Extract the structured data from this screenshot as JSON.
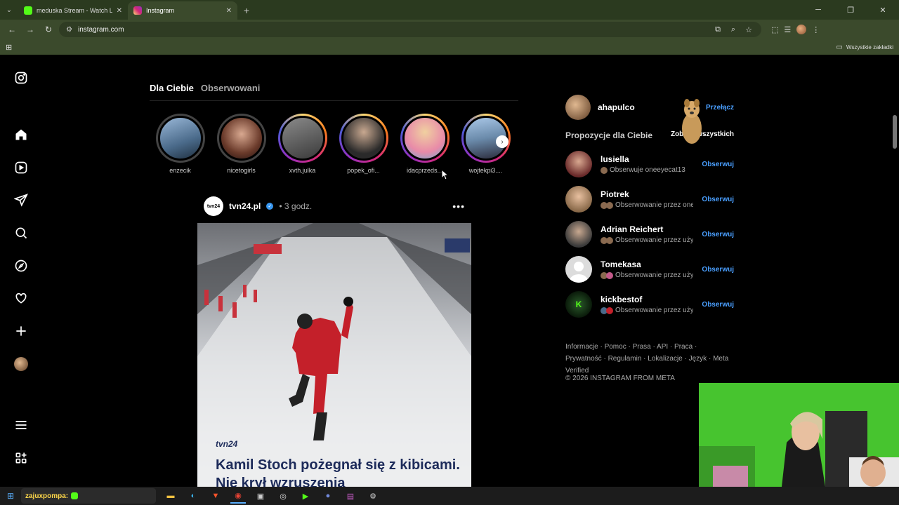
{
  "browser": {
    "tabs": [
      {
        "title": "meduska Stream - Watch Live o",
        "favicon_color": "#53fc18",
        "active": false
      },
      {
        "title": "Instagram",
        "favicon_color": "#e1306c",
        "active": true
      }
    ],
    "url": "instagram.com",
    "bookmarks_all_label": "Wszystkie zakładki"
  },
  "feed": {
    "tab_for_you": "Dla Ciebie",
    "tab_following": "Obserwowani"
  },
  "stories": [
    {
      "name": "enzecik",
      "ring": "seen",
      "color": "#4a6a8a"
    },
    {
      "name": "nicetogirls",
      "ring": "seen",
      "color": "#6a3a2a"
    },
    {
      "name": "xvth.julka",
      "ring": "new",
      "color": "#5a5a5a"
    },
    {
      "name": "popek_ofi...",
      "ring": "new",
      "color": "#2a2a2a"
    },
    {
      "name": "idacprzeds...",
      "ring": "new",
      "color": "#e88aa8"
    },
    {
      "name": "wojtekpi3....",
      "ring": "new",
      "color": "#6a8aaa"
    }
  ],
  "post": {
    "avatar_text": "tvn24",
    "author": "tvn24.pl",
    "time": "• 3 godz.",
    "brand": "tvn24",
    "headline": "Kamil Stoch pożegnał się z kibicami. Nie krył wzruszenia"
  },
  "sidebar_right": {
    "me_name": "ahapulco",
    "switch_label": "Przełącz",
    "suggestions_title": "Propozycje dla Ciebie",
    "see_all": "Zobacz wszystkich",
    "suggestions": [
      {
        "name": "lusiella",
        "sub": "Obserwuje oneeyecat13",
        "follow": "Obserwuj",
        "color": "#6a2a2a"
      },
      {
        "name": "Piotrek",
        "sub": "Obserwowanie przez onee",
        "follow": "Obserwuj",
        "color": "#8a6a4a"
      },
      {
        "name": "Adrian Reichert",
        "sub": "Obserwowanie przez użyt",
        "follow": "Obserwuj",
        "color": "#4a4a4a"
      },
      {
        "name": "Tomekasa",
        "sub": "Obserwowanie przez użyt",
        "follow": "Obserwuj",
        "color": "#dcdcdc"
      },
      {
        "name": "kickbestof",
        "sub": "Obserwowanie przez użyt",
        "follow": "Obserwuj",
        "color": "#1a3a1a"
      }
    ],
    "footer_links": "Informacje · Pomoc · Prasa · API · Praca · Prywatność · Regulamin · Lokalizacje · Język · Meta Verified",
    "copyright": "© 2026 INSTAGRAM FROM META"
  },
  "taskbar": {
    "search_text": "zajuxpompa: ",
    "accent": "#53fc18"
  }
}
